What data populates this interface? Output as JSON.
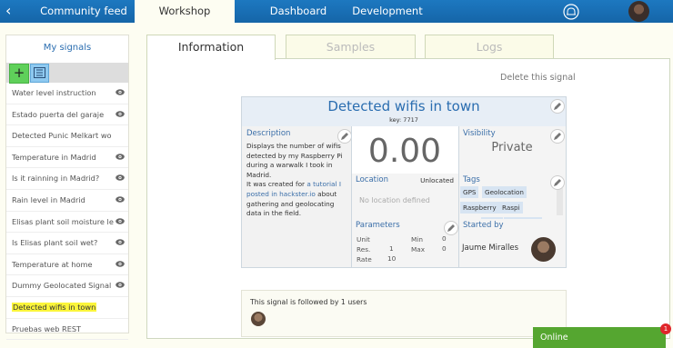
{
  "topnav": {
    "items": [
      {
        "label": "Community feed"
      },
      {
        "label": "Workshop"
      },
      {
        "label": "Dashboard"
      },
      {
        "label": "Development"
      }
    ]
  },
  "sidebar": {
    "title": "My signals",
    "signals": [
      {
        "label": "Water level instruction"
      },
      {
        "label": "Estado puerta del garaje"
      },
      {
        "label": "Detected Punic Melkart wo"
      },
      {
        "label": "Temperature in Madrid"
      },
      {
        "label": "Is it rainning in Madrid?"
      },
      {
        "label": "Rain level in Madrid"
      },
      {
        "label": "Elisas plant soil moisture le"
      },
      {
        "label": "Is Elisas plant soil wet?"
      },
      {
        "label": "Temperature at home"
      },
      {
        "label": "Dummy Geolocated Signal"
      },
      {
        "label": "Detected wifis in town"
      },
      {
        "label": "Pruebas web REST"
      }
    ]
  },
  "tabs": [
    {
      "label": "Information"
    },
    {
      "label": "Samples"
    },
    {
      "label": "Logs"
    }
  ],
  "delete_label": "Delete this signal",
  "signal": {
    "title": "Detected wifis in town",
    "key": "key: 7717",
    "description_label": "Description",
    "description_lines": [
      "Displays the number of wifis",
      "detected by my Raspberry Pi",
      "during a warwalk I took in",
      "Madrid."
    ],
    "description_created_pre": "It was created for ",
    "description_link_1": "a tutorial I",
    "description_link_2": "posted in hackster.io",
    "description_created_post": " about",
    "description_tail_1": "gathering and geolocating",
    "description_tail_2": "data in the field.",
    "value": "0.00",
    "visibility_label": "Visibility",
    "visibility_value": "Private",
    "location_label": "Location",
    "location_status": "Unlocated",
    "location_empty": "No location defined",
    "tags_label": "Tags",
    "tags": [
      "GPS",
      "Geolocation",
      "Raspberry",
      "Raspi"
    ],
    "parameters_label": "Parameters",
    "param_unit_label": "Unit",
    "param_unit_value": "",
    "param_res_label": "Res.",
    "param_res_value": "1",
    "param_rate_label": "Rate",
    "param_rate_value": "10",
    "param_min_label": "Min",
    "param_min_value": "0",
    "param_max_label": "Max",
    "param_max_value": "0",
    "started_by_label": "Started by",
    "started_by_name": "Jaume Miralles"
  },
  "followers": {
    "text": "This signal is followed by 1 users"
  },
  "chat": {
    "label": "Online",
    "badge": "1"
  },
  "colors": {
    "nav_bar": "#1d78c0",
    "selected_signal": "#fbf53b",
    "online_bar": "#55a630",
    "add_button": "#5fd05a"
  }
}
